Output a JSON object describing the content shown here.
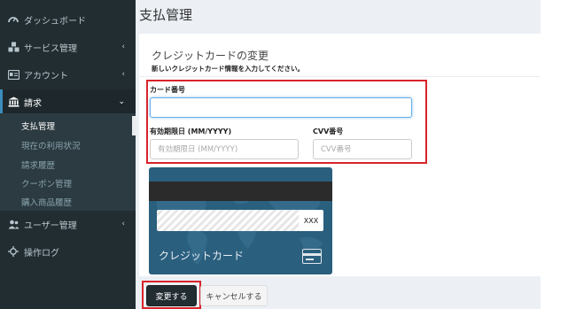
{
  "sidebar": {
    "items": [
      {
        "label": "ダッシュボード",
        "icon": "dashboard-icon"
      },
      {
        "label": "サービス管理",
        "icon": "cubes-icon"
      },
      {
        "label": "アカウント",
        "icon": "id-card-icon"
      },
      {
        "label": "請求",
        "icon": "bank-icon"
      },
      {
        "label": "ユーザー管理",
        "icon": "users-icon"
      },
      {
        "label": "操作ログ",
        "icon": "crosshairs-icon"
      }
    ],
    "billing_submenu": [
      "支払管理",
      "現在の利用状況",
      "請求履歴",
      "クーポン管理",
      "購入商品履歴"
    ]
  },
  "page": {
    "title": "支払管理"
  },
  "box": {
    "title": "クレジットカードの変更",
    "subtitle": "新しいクレジットカード情報を入力してください。"
  },
  "form": {
    "card_number_label": "カード番号",
    "card_number_value": "",
    "expiry_label": "有効期限日 (MM/YYYY)",
    "expiry_placeholder": "有効期限日 (MM/YYYY)",
    "cvv_label": "CVV番号",
    "cvv_placeholder": "CVV番号"
  },
  "card_image": {
    "cvv_text": "XXX",
    "name_text": "クレジットカード"
  },
  "buttons": {
    "submit": "変更する",
    "cancel": "キャンセルする"
  },
  "colors": {
    "sidebar_bg": "#222d32",
    "highlight": "#d9232a",
    "card_bg": "#2a5f7e"
  }
}
